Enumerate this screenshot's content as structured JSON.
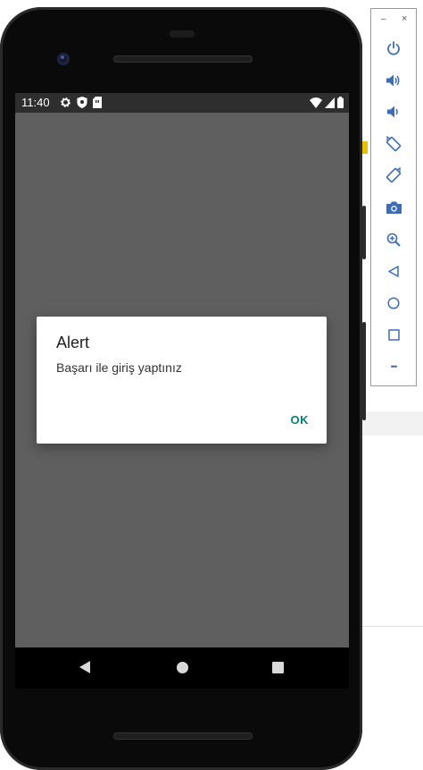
{
  "status_bar": {
    "time": "11:40"
  },
  "dialog": {
    "title": "Alert",
    "message": "Başarı ile giriş yaptınız",
    "ok_label": "OK"
  },
  "toolbar": {
    "minimize_label": "–",
    "close_label": "×",
    "items": [
      "power-icon",
      "volume-up-icon",
      "volume-down-icon",
      "rotate-left-icon",
      "rotate-right-icon",
      "camera-icon",
      "zoom-icon",
      "back-icon",
      "home-icon",
      "overview-icon",
      "more-icon"
    ],
    "more_label": "•••"
  },
  "colors": {
    "accent": "#008577",
    "screen_dim": "#5f5f5f",
    "statusbar": "#2e2e2e",
    "toolbar_icon": "#3f6db5"
  }
}
